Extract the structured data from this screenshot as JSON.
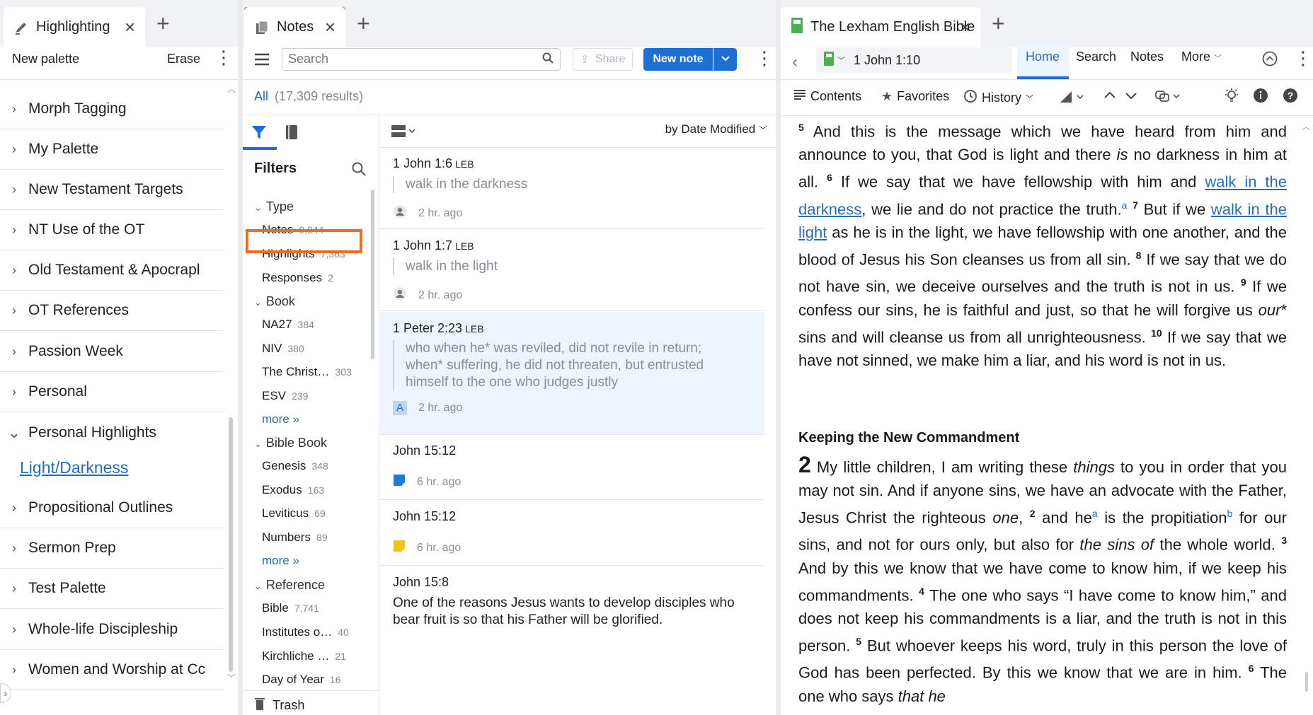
{
  "highlighting": {
    "tab_title": "Highlighting",
    "new_palette": "New palette",
    "erase": "Erase",
    "palettes": [
      {
        "label": "Morph Tagging",
        "expanded": false
      },
      {
        "label": "My Palette",
        "expanded": false
      },
      {
        "label": "New Testament Targets",
        "expanded": false
      },
      {
        "label": "NT Use of the OT",
        "expanded": false
      },
      {
        "label": "Old Testament & Apocrapl",
        "expanded": false
      },
      {
        "label": "OT References",
        "expanded": false
      },
      {
        "label": "Passion Week",
        "expanded": false
      },
      {
        "label": "Personal",
        "expanded": false
      },
      {
        "label": "Personal Highlights",
        "expanded": true
      },
      {
        "label": "Propositional Outlines",
        "expanded": false
      },
      {
        "label": "Sermon Prep",
        "expanded": false
      },
      {
        "label": "Test Palette",
        "expanded": false
      },
      {
        "label": "Whole-life Discipleship",
        "expanded": false
      },
      {
        "label": "Women and Worship at Cc",
        "expanded": false
      }
    ],
    "expanded_child": "Light/Darkness"
  },
  "notes": {
    "tab_title": "Notes",
    "search_placeholder": "Search",
    "share": "Share",
    "new_note": "New note",
    "all_label": "All",
    "results": "(17,309 results)",
    "sort": "by Date Modified",
    "filters_title": "Filters",
    "filter_groups": [
      {
        "heading": "Type",
        "items": [
          {
            "label": "Notes",
            "count": "9,944"
          },
          {
            "label": "Highlights",
            "count": "7,363"
          },
          {
            "label": "Responses",
            "count": "2"
          }
        ]
      },
      {
        "heading": "Book",
        "items": [
          {
            "label": "NA27",
            "count": "384"
          },
          {
            "label": "NIV",
            "count": "380"
          },
          {
            "label": "The Christ…",
            "count": "303"
          },
          {
            "label": "ESV",
            "count": "239"
          }
        ],
        "more": "more »"
      },
      {
        "heading": "Bible Book",
        "items": [
          {
            "label": "Genesis",
            "count": "348"
          },
          {
            "label": "Exodus",
            "count": "163"
          },
          {
            "label": "Leviticus",
            "count": "69"
          },
          {
            "label": "Numbers",
            "count": "89"
          }
        ],
        "more": "more »"
      },
      {
        "heading": "Reference",
        "items": [
          {
            "label": "Bible",
            "count": "7,741"
          },
          {
            "label": "Institutes o…",
            "count": "40"
          },
          {
            "label": "Kirchliche …",
            "count": "21"
          },
          {
            "label": "Day of Year",
            "count": "16"
          }
        ]
      }
    ],
    "trash": "Trash",
    "entries": [
      {
        "ref": "1 John 1:6",
        "version": "LEB",
        "quote": "walk in the darkness",
        "time": "2 hr. ago"
      },
      {
        "ref": "1 John 1:7",
        "version": "LEB",
        "quote": "walk in the light",
        "time": "2 hr. ago"
      },
      {
        "ref": "1 Peter 2:23",
        "version": "LEB",
        "quote_line1": "who when he* was reviled, did not revile in return;",
        "quote_line2": "when* suffering, he did not threaten, but entrusted",
        "quote_line3": "himself to the one who judges justly",
        "time": "2 hr. ago",
        "badge": "A"
      },
      {
        "ref": "John 15:12",
        "time": "6 hr. ago"
      },
      {
        "ref": "John 15:12",
        "time": "6 hr. ago"
      },
      {
        "ref": "John 15:8",
        "body_line1": "One of the reasons Jesus wants to develop disciples who",
        "body_line2": "bear fruit is so that his Father will be glorified."
      }
    ]
  },
  "bible": {
    "tab_title": "The Lexham English Bible",
    "reference": "1 John 1:10",
    "nav_tabs": [
      "Home",
      "Search",
      "Notes",
      "More"
    ],
    "active_tab": "Home",
    "toolbar": {
      "contents": "Contents",
      "favorites": "Favorites",
      "history": "History"
    },
    "heading": "Keeping the New Commandment",
    "chapter": "2"
  },
  "colors": {
    "accent": "#1f6fd1",
    "highlight_box": "#e8701f",
    "link": "#2b6cb0",
    "selected_note": "#eef4fb"
  }
}
